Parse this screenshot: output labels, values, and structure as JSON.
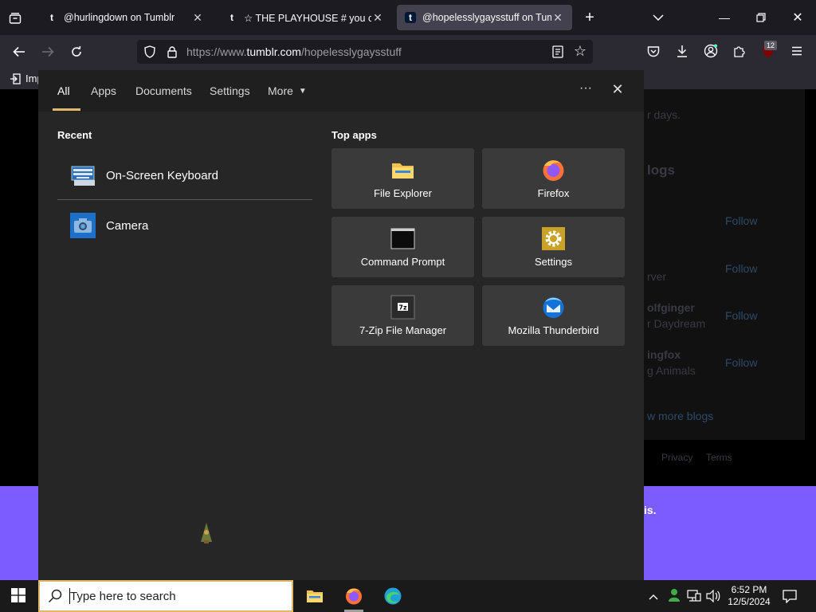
{
  "browser": {
    "tabs": [
      {
        "title": "@hurlingdown on Tumblr",
        "favicon": "t",
        "active": false
      },
      {
        "title": "☆ THE PLAYHOUSE # you can f",
        "favicon": "t",
        "active": false
      },
      {
        "title": "@hopelesslygaysstuff on Tumbl",
        "favicon": "t",
        "active": true
      }
    ],
    "url_prefix": "https://www.",
    "url_domain": "tumblr.com",
    "url_path": "/hopelesslygaysstuff",
    "bookmark_label": "Imp",
    "extension_badge": "12"
  },
  "page_bg": {
    "fragments": [
      "r days.",
      "logs",
      "Follow",
      "Follow",
      "Follow",
      "Follow",
      "rver",
      "olfginger",
      "r Daydream",
      "ingfox",
      "g Animals",
      "w more blogs",
      "Privacy",
      "Terms",
      "is."
    ]
  },
  "start_menu": {
    "tabs": [
      "All",
      "Apps",
      "Documents",
      "Settings",
      "More"
    ],
    "selected_tab": "All",
    "more_arrow": "▼",
    "options_label": "···",
    "close_label": "✕",
    "recent_heading": "Recent",
    "recent": [
      {
        "label": "On-Screen Keyboard",
        "icon": "keyboard-icon"
      },
      {
        "label": "Camera",
        "icon": "camera-icon"
      }
    ],
    "top_apps_heading": "Top apps",
    "top_apps": [
      {
        "label": "File Explorer",
        "icon": "folder-icon"
      },
      {
        "label": "Firefox",
        "icon": "firefox-icon"
      },
      {
        "label": "Command Prompt",
        "icon": "terminal-icon"
      },
      {
        "label": "Settings",
        "icon": "gear-icon"
      },
      {
        "label": "7-Zip File Manager",
        "icon": "archive-icon"
      },
      {
        "label": "Mozilla Thunderbird",
        "icon": "thunderbird-icon"
      }
    ]
  },
  "taskbar": {
    "search_placeholder": "Type here to search",
    "time": "6:52 PM",
    "date": "12/5/2024"
  },
  "colors": {
    "accent": "#e2b96a",
    "tumblr_purple": "#7c5cff"
  }
}
